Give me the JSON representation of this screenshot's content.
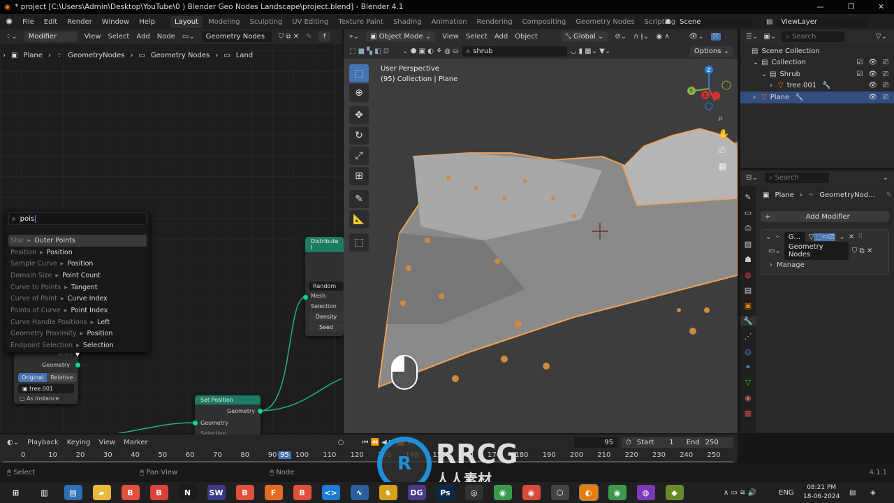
{
  "window": {
    "title": "* project [C:\\Users\\Admin\\Desktop\\YouTube\\0 ) Blender Geo Nodes Landscape\\project.blend] - Blender 4.1",
    "controls": [
      "—",
      "❐",
      "✕"
    ]
  },
  "menu": [
    "File",
    "Edit",
    "Render",
    "Window",
    "Help"
  ],
  "workspaces": [
    {
      "label": "Layout",
      "active": true
    },
    {
      "label": "Modeling"
    },
    {
      "label": "Sculpting"
    },
    {
      "label": "UV Editing"
    },
    {
      "label": "Texture Paint"
    },
    {
      "label": "Shading"
    },
    {
      "label": "Animation"
    },
    {
      "label": "Rendering"
    },
    {
      "label": "Compositing"
    },
    {
      "label": "Geometry Nodes"
    },
    {
      "label": "Scripting"
    }
  ],
  "scene": "Scene",
  "view_layer": "ViewLayer",
  "node_editor": {
    "header": {
      "type": "Modifier",
      "menus": [
        "View",
        "Select",
        "Add",
        "Node"
      ],
      "tree": "Geometry Nodes"
    },
    "breadcrumb": [
      "Plane",
      "GeometryNodes",
      "Geometry Nodes",
      "Land"
    ],
    "search": {
      "query": "pois",
      "results": [
        {
          "ctx": "Star",
          "item": "Outer Points"
        },
        {
          "ctx": "Position",
          "item": "Position"
        },
        {
          "ctx": "Sample Curve",
          "item": "Position"
        },
        {
          "ctx": "Domain Size",
          "item": "Point Count"
        },
        {
          "ctx": "Curve to Points",
          "item": "Tangent"
        },
        {
          "ctx": "Curve of Point",
          "item": "Curve Index"
        },
        {
          "ctx": "Points of Curve",
          "item": "Point Index"
        },
        {
          "ctx": "Curve Handle Positions",
          "item": "Left"
        },
        {
          "ctx": "Geometry Proximity",
          "item": "Position"
        },
        {
          "ctx": "Endpoint Selection",
          "item": "Selection"
        }
      ]
    },
    "nodes": {
      "distribute": {
        "title": "Distribute I",
        "mode": "Random",
        "inputs": [
          "Mesh",
          "Selection",
          "Density",
          "Seed"
        ]
      },
      "object_info": {
        "partial": "Scale",
        "output": "Geometry",
        "toggle": [
          "Original",
          "Relative"
        ],
        "object": "tree.001",
        "as_instance": "As Instance"
      },
      "set_position": {
        "title": "Set Position",
        "output": "Geometry",
        "inputs": [
          "Geometry",
          "Selection"
        ]
      }
    }
  },
  "viewport": {
    "mode": "Object Mode",
    "menus": [
      "View",
      "Select",
      "Add",
      "Object"
    ],
    "orientation": "Global",
    "filter": "shrub",
    "options": "Options",
    "overlay_text": [
      "User Perspective",
      "(95) Collection | Plane"
    ],
    "axes": [
      "Z",
      "Y",
      "X"
    ],
    "colors": {
      "terrain": "#8a8a8a",
      "outline": "#f0a050",
      "background": "#3d3d3d"
    }
  },
  "outliner": {
    "search_placeholder": "Search",
    "items": [
      {
        "label": "Scene Collection",
        "depth": 0
      },
      {
        "label": "Collection",
        "depth": 1
      },
      {
        "label": "Shrub",
        "depth": 2
      },
      {
        "label": "tree.001",
        "depth": 3
      },
      {
        "label": "Plane",
        "depth": 1,
        "selected": true
      }
    ]
  },
  "properties": {
    "search_placeholder": "Search",
    "breadcrumb": [
      "Plane",
      "GeometryNod..."
    ],
    "add_modifier": "Add Modifier",
    "modifier_name": "G...",
    "node_group": "Geometry Nodes",
    "manage": "Manage"
  },
  "timeline": {
    "menus": [
      "Playback",
      "Keying",
      "View",
      "Marker"
    ],
    "current_frame": "95",
    "start_label": "Start",
    "start": "1",
    "end_label": "End",
    "end": "250",
    "ticks": [
      "0",
      "10",
      "20",
      "30",
      "40",
      "50",
      "60",
      "70",
      "80",
      "90",
      "100",
      "110",
      "120",
      "130",
      "140",
      "150",
      "160",
      "170",
      "180",
      "190",
      "200",
      "210",
      "220",
      "230",
      "240",
      "250"
    ]
  },
  "status": {
    "items": [
      "Select",
      "Pan View",
      "Node"
    ],
    "version": "4.1.1"
  },
  "watermark": {
    "text": "RRCG",
    "sub": "人人素材"
  },
  "taskbar": {
    "lang": "ENG",
    "time": "08:21 PM",
    "date": "18-06-2024",
    "apps": [
      {
        "n": "start",
        "c": "#202020",
        "g": "⊞"
      },
      {
        "n": "task-view",
        "c": "#202020",
        "g": "▥"
      },
      {
        "n": "explorer",
        "c": "#2d6fb3",
        "g": "▤"
      },
      {
        "n": "files",
        "c": "#e8b93a",
        "g": "▰"
      },
      {
        "n": "brave-1",
        "c": "#e0503a",
        "g": "B"
      },
      {
        "n": "brave-2",
        "c": "#d9433a",
        "g": "B"
      },
      {
        "n": "notion",
        "c": "#1b1b1b",
        "g": "N"
      },
      {
        "n": "sw",
        "c": "#3a3a8a",
        "g": "SW"
      },
      {
        "n": "brave-3",
        "c": "#e0503a",
        "g": "B"
      },
      {
        "n": "firefox",
        "c": "#e56a24",
        "g": "F"
      },
      {
        "n": "brave-4",
        "c": "#e0503a",
        "g": "B"
      },
      {
        "n": "vscode",
        "c": "#1d7bd6",
        "g": "<>"
      },
      {
        "n": "app-blue",
        "c": "#2a5f9e",
        "g": "∿"
      },
      {
        "n": "app-yellow",
        "c": "#d4a21a",
        "g": "♞"
      },
      {
        "n": "dg",
        "c": "#4a3a8a",
        "g": "DG"
      },
      {
        "n": "photoshop",
        "c": "#0b2a4a",
        "g": "Ps"
      },
      {
        "n": "obs",
        "c": "#333",
        "g": "◎"
      },
      {
        "n": "chrome-1",
        "c": "#3a9a4a",
        "g": "◉"
      },
      {
        "n": "chrome-2",
        "c": "#d84a3a",
        "g": "◉"
      },
      {
        "n": "unity",
        "c": "#444",
        "g": "⬡"
      },
      {
        "n": "blender",
        "c": "#e87d0d",
        "g": "◐"
      },
      {
        "n": "chrome-3",
        "c": "#3a9a4a",
        "g": "◉"
      },
      {
        "n": "github",
        "c": "#7a3ab8",
        "g": "◍"
      },
      {
        "n": "app-green",
        "c": "#6a8a2a",
        "g": "◆"
      }
    ]
  }
}
